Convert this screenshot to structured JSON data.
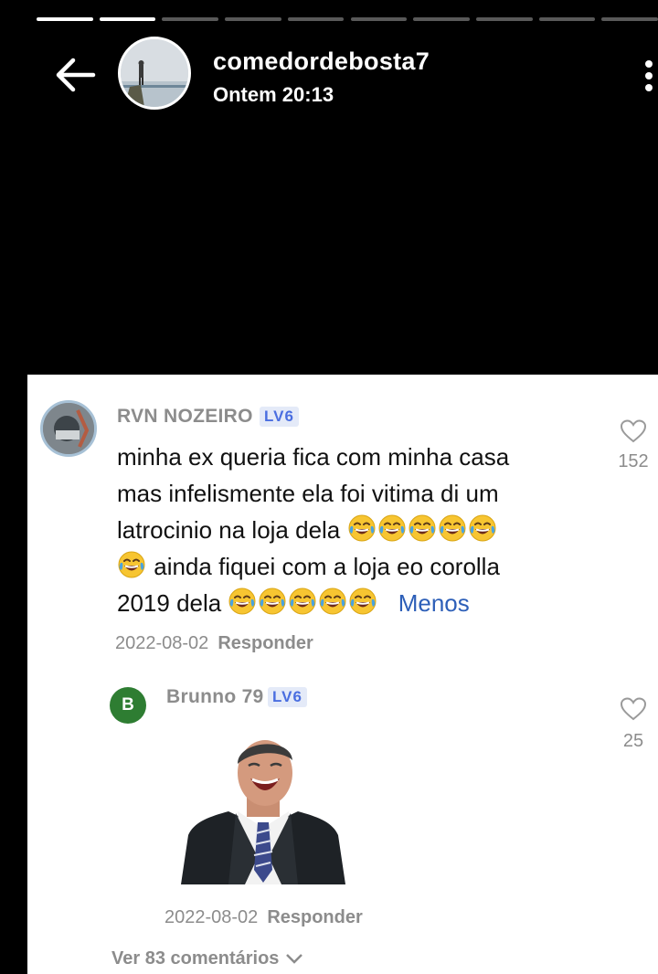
{
  "story": {
    "progress_segments": 10,
    "progress_active": 2,
    "username": "comedordebosta7",
    "timestamp": "Ontem 20:13"
  },
  "comments": [
    {
      "author": "RVN NOZEIRO",
      "level": "LV6",
      "text_line1": "minha ex queria fica com minha casa",
      "text_line2": "mas infelismente ela foi vitima di um",
      "text_line3": "latrocinio na loja dela",
      "text_line4": "ainda fiquei com a loja eo corolla",
      "text_line5": "2019 dela",
      "emoji": "😂",
      "collapse_link": "Menos",
      "date": "2022-08-02",
      "reply_label": "Responder",
      "likes": "152"
    },
    {
      "author_initial": "B",
      "author": "Brunno 79",
      "level": "LV6",
      "date": "2022-08-02",
      "reply_label": "Responder",
      "likes": "25"
    }
  ],
  "footer": {
    "view_more": "Ver 83 comentários"
  },
  "colors": {
    "background": "#000000",
    "card": "#ffffff",
    "muted": "#8c8c8c",
    "level_badge": "#4a6ee0",
    "link": "#2d5fb8"
  }
}
